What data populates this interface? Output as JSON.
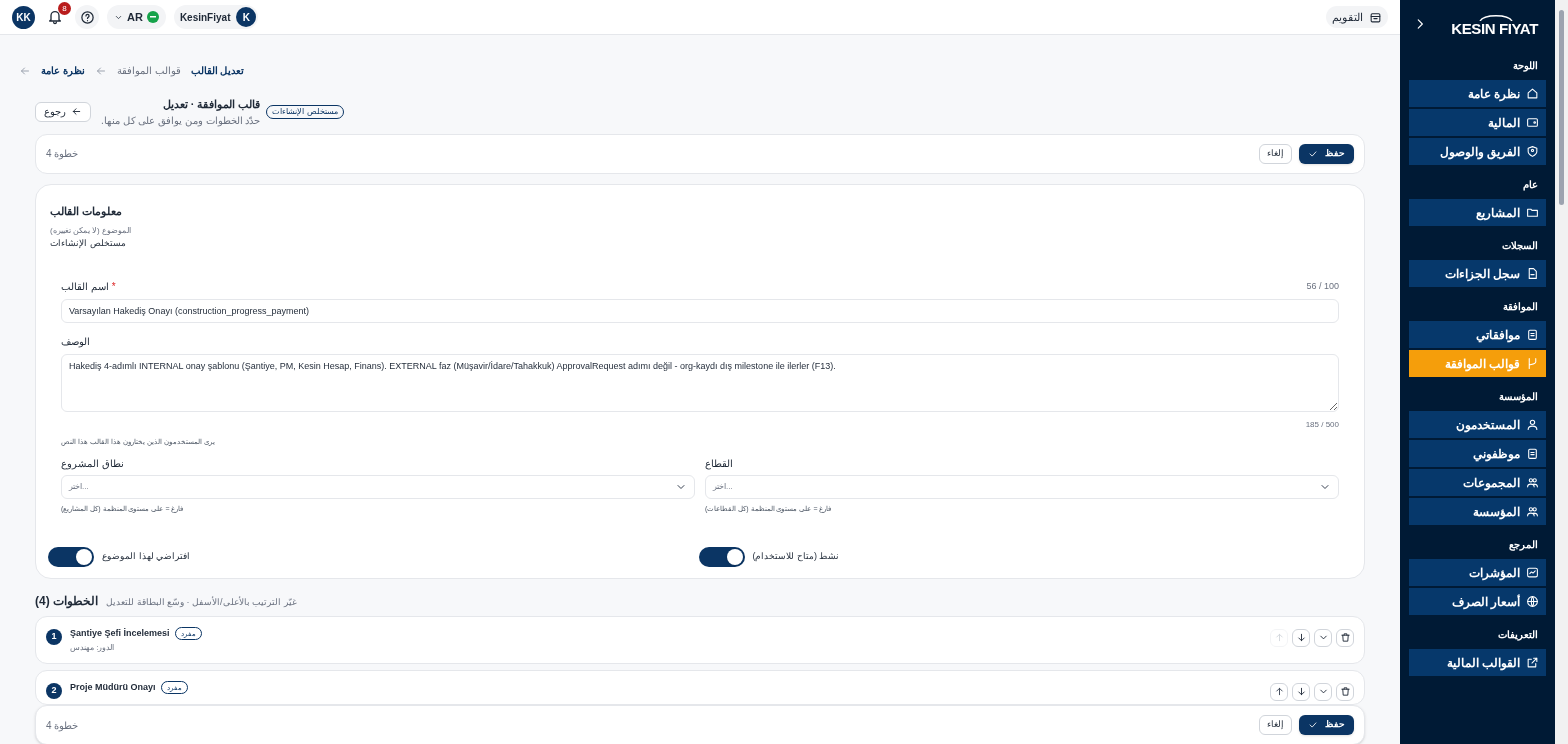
{
  "topbar": {
    "user_initials": "KK",
    "notifications": "8",
    "language": "AR",
    "org_name": "KesinFiyat",
    "org_initial": "K",
    "calendar": "التقويم"
  },
  "breadcrumb": [
    {
      "label": "تعديل القالب",
      "muted": false
    },
    {
      "label": "قوالب الموافقة",
      "muted": true
    },
    {
      "label": "نظرة عامة",
      "muted": false
    }
  ],
  "header": {
    "back": "رجوع",
    "title": "قالب الموافقة · تعديل",
    "subtitle": "حدّد الخطوات ومن يوافق على كل منها.",
    "badge": "مستخلص الإنشاءات"
  },
  "action_bar": {
    "steps": "خطوة 4",
    "cancel": "إلغاء",
    "save": "حفظ"
  },
  "info": {
    "title": "معلومات القالب",
    "subject_label": "الموضوع (لا يمكن تغييره)",
    "subject": "مستخلص الإنشاءات",
    "name_label": "اسم القالب",
    "required_mark": "*",
    "name_counter": "56 / 100",
    "name_value": "Varsayılan Hakediş Onayı (construction_progress_payment)",
    "desc_label": "الوصف",
    "desc_value": "Hakediş 4-adımlı INTERNAL onay şablonu (Şantiye, PM, Kesin Hesap, Finans). EXTERNAL faz (Müşavir/İdare/Tahakkuk) ApprovalRequest adımı değil - org-kaydı dış milestone ile ilerler (F13).",
    "desc_counter": "185 / 500",
    "desc_help": "يرى المستخدمون الذين يختارون هذا القالب هذا النص",
    "selects": [
      {
        "label": "القطاع",
        "placeholder": "اختر...",
        "hint": "فارغ = على مستوى المنظمة (كل القطاعات)"
      },
      {
        "label": "نطاق المشروع",
        "placeholder": "اختر...",
        "hint": "فارغ = على مستوى المنظمة (كل المشاريع)"
      }
    ],
    "toggles": [
      {
        "label": "نشط (متاح للاستخدام)",
        "on": true
      },
      {
        "label": "افتراضي لهذا الموضوع",
        "on": true
      }
    ]
  },
  "steps": {
    "title": "الخطوات (4)",
    "hint": "غيّر الترتيب بالأعلى/الأسفل · وسّع البطاقة للتعديل",
    "items": [
      {
        "number": "1",
        "name": "Şantiye Şefi İncelemesi",
        "badge": "مفرد",
        "role": "الدور: مهندس",
        "can_move_up": false
      },
      {
        "number": "2",
        "name": "Proje Müdürü Onayı",
        "badge": "مفرد",
        "can_move_up": true
      }
    ]
  },
  "bottom_bar": {
    "steps": "خطوة 4",
    "cancel": "إلغاء",
    "save": "حفظ"
  },
  "sidebar": {
    "logo": "KESIN FIYAT",
    "sections": [
      {
        "title": "اللوحة",
        "items": [
          {
            "label": "نظرة عامة",
            "selected": false
          },
          {
            "label": "المالية",
            "selected": false
          },
          {
            "label": "الفريق والوصول",
            "selected": false
          }
        ]
      },
      {
        "title": "عام",
        "items": [
          {
            "label": "المشاريع",
            "selected": false
          }
        ]
      },
      {
        "title": "السجلات",
        "items": [
          {
            "label": "سجل الجزاءات",
            "selected": false
          }
        ]
      },
      {
        "title": "الموافقة",
        "items": [
          {
            "label": "موافقاتي",
            "selected": false
          },
          {
            "label": "قوالب الموافقة",
            "selected": true
          }
        ]
      },
      {
        "title": "المؤسسة",
        "items": [
          {
            "label": "المستخدمون",
            "selected": false
          },
          {
            "label": "موظفوني",
            "selected": false
          },
          {
            "label": "المجموعات",
            "selected": false
          },
          {
            "label": "المؤسسة",
            "selected": false
          }
        ]
      },
      {
        "title": "المرجع",
        "items": [
          {
            "label": "المؤشرات",
            "selected": false
          },
          {
            "label": "أسعار الصرف",
            "selected": false
          }
        ]
      },
      {
        "title": "التعريفات",
        "items": [
          {
            "label": "القوالب المالية",
            "selected": false
          }
        ]
      }
    ]
  }
}
